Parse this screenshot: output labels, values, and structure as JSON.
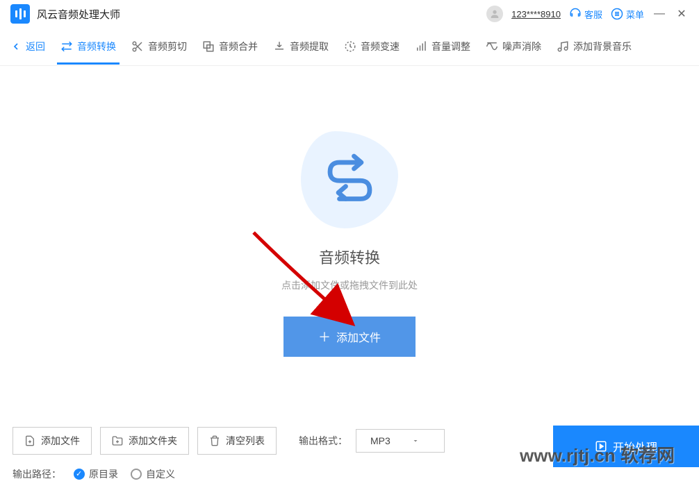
{
  "header": {
    "app_title": "风云音频处理大师",
    "user_id": "123****8910",
    "support_label": "客服",
    "menu_label": "菜单"
  },
  "tabs": {
    "back": "返回",
    "items": [
      {
        "label": "音频转换"
      },
      {
        "label": "音频剪切"
      },
      {
        "label": "音频合并"
      },
      {
        "label": "音频提取"
      },
      {
        "label": "音频变速"
      },
      {
        "label": "音量调整"
      },
      {
        "label": "噪声消除"
      },
      {
        "label": "添加背景音乐"
      }
    ]
  },
  "main": {
    "title": "音频转换",
    "subtitle": "点击添加文件或拖拽文件到此处",
    "add_button": "添加文件"
  },
  "bottom": {
    "add_file": "添加文件",
    "add_folder": "添加文件夹",
    "clear_list": "清空列表",
    "output_format_label": "输出格式：",
    "output_format_value": "MP3",
    "start_button": "开始处理",
    "output_path_label": "输出路径：",
    "radio_original": "原目录",
    "radio_custom": "自定义"
  },
  "watermark": "www.rjtj.cn 软荐网"
}
